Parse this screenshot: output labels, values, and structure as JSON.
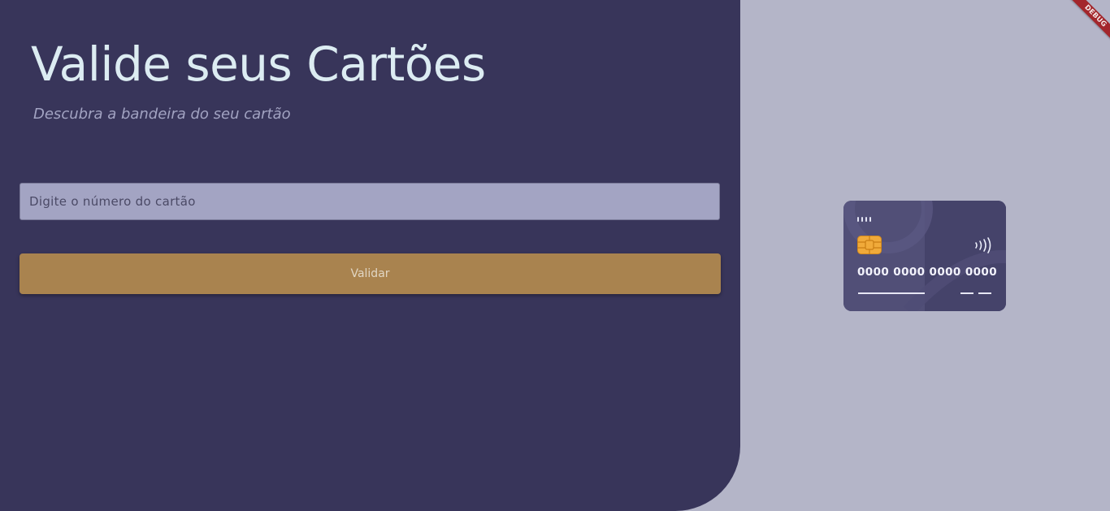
{
  "header": {
    "title": "Valide seus Cartões",
    "subtitle": "Descubra a bandeira do seu cartão"
  },
  "form": {
    "card_input": {
      "placeholder": "Digite o número do cartão",
      "value": ""
    },
    "validate_label": "Validar"
  },
  "card_preview": {
    "number": "0000 0000 0000 0000"
  },
  "debug_banner": {
    "label": "DEBUG"
  },
  "colors": {
    "panel": "#38355a",
    "background": "#b4b5c8",
    "title": "#dcecf2",
    "button": "#a9834f",
    "input": "#a3a4c3",
    "card": "#48466c",
    "chip": "#f0aa3a",
    "debug": "#a3262c"
  }
}
